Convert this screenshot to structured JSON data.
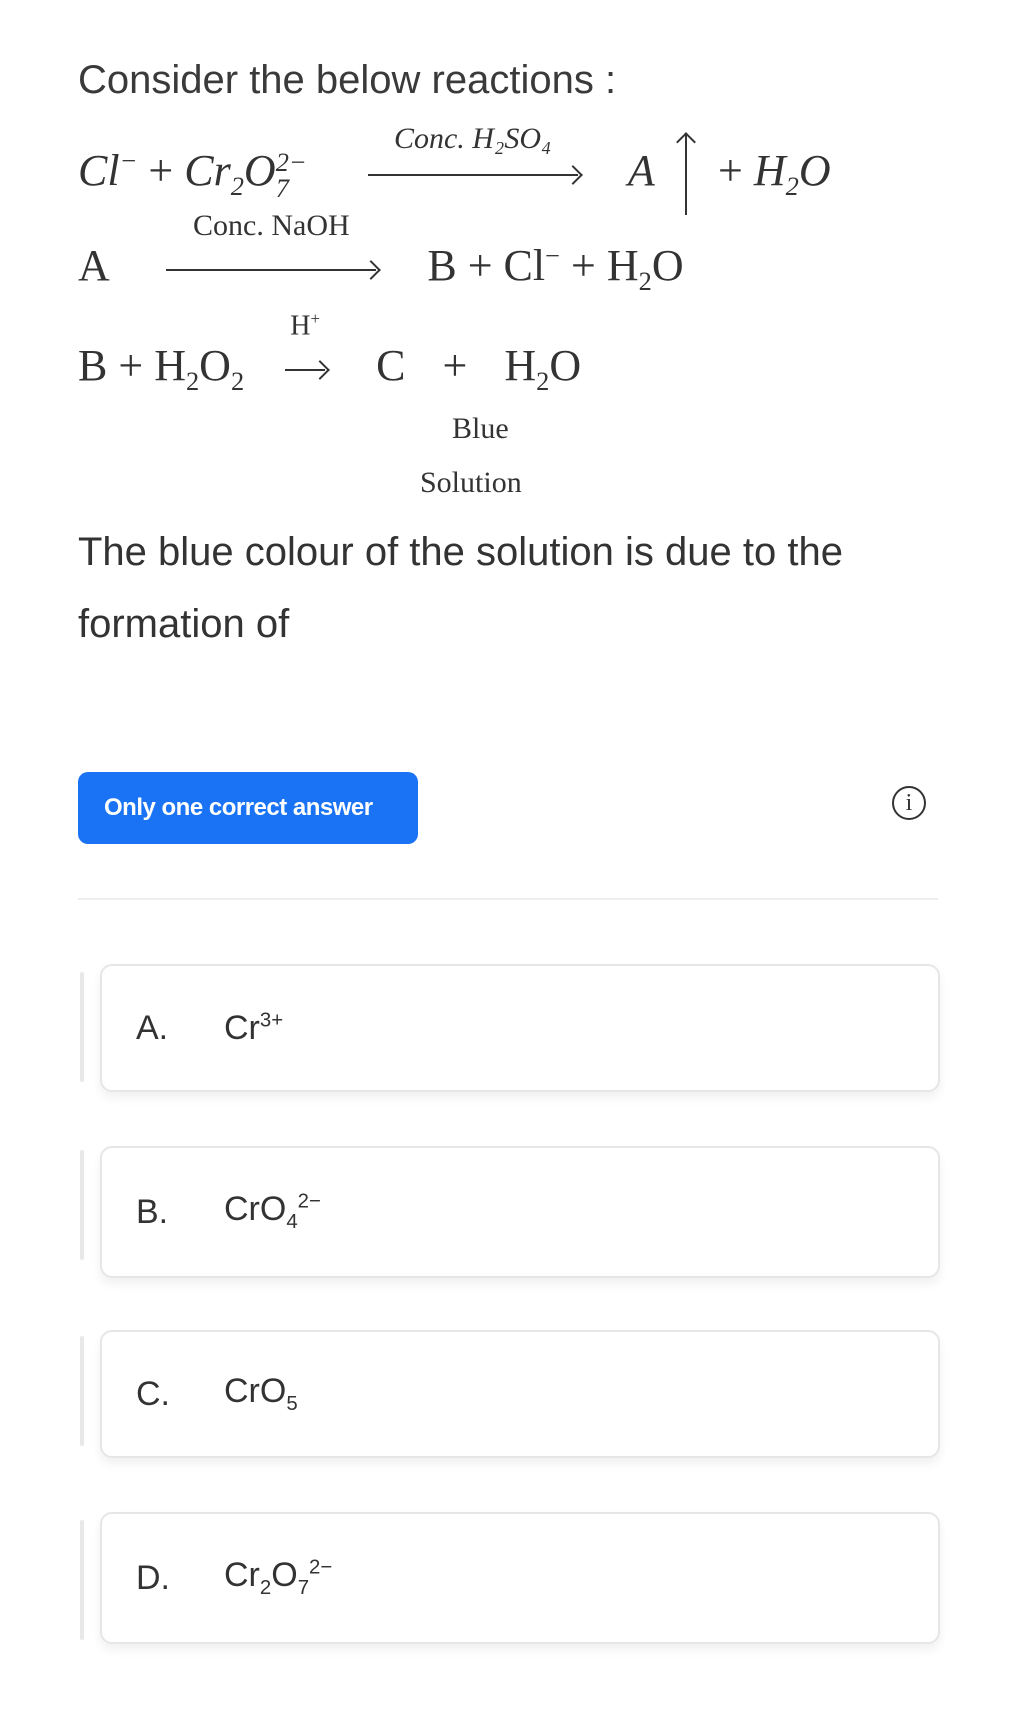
{
  "intro": "Consider the below reactions :",
  "reactions": {
    "r1": {
      "lhs_a": "Cl",
      "lhs_a_charge": "−",
      "plus": "+",
      "lhs_b": "Cr",
      "lhs_b_sub1": "2",
      "lhs_b_o": "O",
      "lhs_b_sub2": "7",
      "lhs_b_charge": "2−",
      "condition": "Conc. H₂SO₄",
      "product": "A",
      "plus2": "+",
      "product2": "H",
      "product2_sub": "2",
      "product2_o": "O"
    },
    "r2": {
      "reactant": "A",
      "condition": "Conc.  NaOH",
      "product_b": "B",
      "plus": "+",
      "product_cl": "Cl",
      "product_cl_charge": "−",
      "plus2": "+",
      "product_h": "H",
      "product_h_sub": "2",
      "product_o": "O"
    },
    "r3": {
      "reactant_b": "B",
      "plus": "+",
      "reactant_h": "H",
      "reactant_h_sub": "2",
      "reactant_o": "O",
      "reactant_o_sub": "2",
      "condition": "H",
      "condition_charge": "+",
      "product_c": "C",
      "plus2": "+",
      "product_h": "H",
      "product_h_sub": "2",
      "product_o": "O",
      "note_line1": "Blue",
      "note_line2": "Solution"
    }
  },
  "question": "The blue colour of the solution is due to the formation of",
  "badge": "Only one correct answer",
  "info_icon": "i",
  "options": [
    {
      "letter": "A.",
      "base": "Cr",
      "sub": "",
      "base2": "",
      "sub2": "",
      "charge": "3+"
    },
    {
      "letter": "B.",
      "base": "CrO",
      "sub": "4",
      "base2": "",
      "sub2": "",
      "charge": "2−"
    },
    {
      "letter": "C.",
      "base": "CrO",
      "sub": "5",
      "base2": "",
      "sub2": "",
      "charge": ""
    },
    {
      "letter": "D.",
      "base": "Cr",
      "sub": "2",
      "base2": "O",
      "sub2": "7",
      "charge": "2−"
    }
  ],
  "colors": {
    "badge_bg": "#1a73f5",
    "text": "#333333"
  }
}
